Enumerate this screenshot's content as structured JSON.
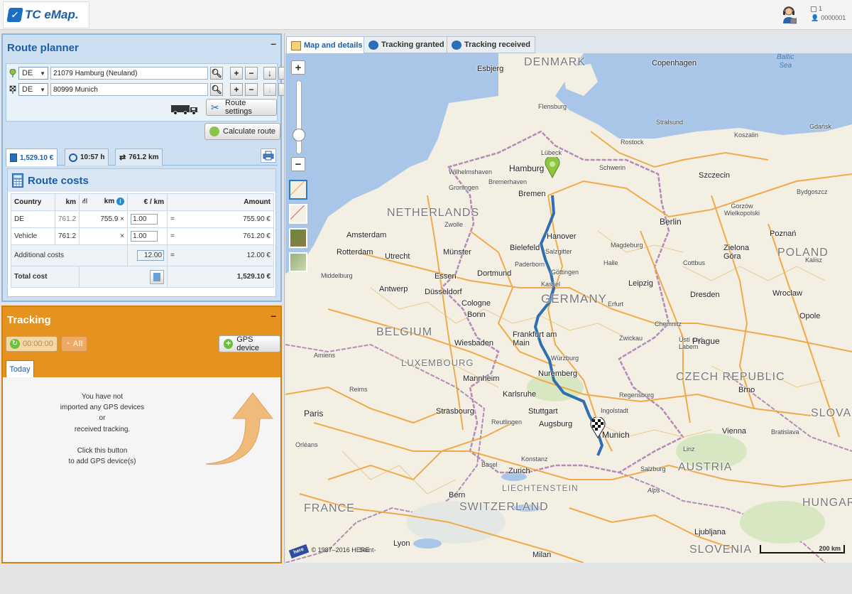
{
  "header": {
    "app_name": "TC eMap.",
    "logo_icon": "tc-logo-icon",
    "support_icon": "support-agent-icon",
    "session_count": "1",
    "account_id": "0000001"
  },
  "route_planner": {
    "title": "Route planner",
    "collapse": "–",
    "start": {
      "country": "DE",
      "address": "21079 Hamburg (Neuland)"
    },
    "end": {
      "country": "DE",
      "address": "80999 Munich"
    },
    "route_settings_label": "Route settings",
    "calculate_label": "Calculate route",
    "summary_tabs": [
      {
        "label": "1,529.10 €",
        "icon": "calculator-icon"
      },
      {
        "label": "10:57 h",
        "icon": "clock-icon"
      },
      {
        "label": "761.2 km",
        "icon": "road-sign-icon"
      }
    ],
    "costs_title": "Route costs",
    "table": {
      "headers": [
        "Country",
        "km",
        "km",
        "€ / km",
        "Amount"
      ],
      "rows": [
        {
          "country": "DE",
          "km": "761.2",
          "toll_km": "755.9 ×",
          "rate": "1.00",
          "eq": "=",
          "amount": "755.90 €"
        },
        {
          "country": "Vehicle",
          "km": "761.2",
          "toll_km": "×",
          "rate": "1.00",
          "eq": "=",
          "amount": "761.20 €"
        }
      ],
      "additional_label": "Additional costs",
      "additional_value": "12.00",
      "additional_eq": "=",
      "additional_amount": "12.00 €",
      "total_label": "Total cost",
      "total_amount": "1,529.10 €"
    }
  },
  "tracking": {
    "title": "Tracking",
    "collapse": "–",
    "timer_label": "00:00:00",
    "all_label": "All",
    "gps_device_label": "GPS device",
    "today_tab": "Today",
    "message_lines": [
      "You have not",
      "imported any GPS devices",
      "or",
      "received tracking.",
      "",
      "Click this button",
      "to add GPS device(s)"
    ]
  },
  "map": {
    "tabs": [
      {
        "label": "Map and details",
        "icon": "map-icon"
      },
      {
        "label": "Tracking granted",
        "icon": "tracking-granted-icon"
      },
      {
        "label": "Tracking received",
        "icon": "tracking-received-icon"
      }
    ],
    "zoom_in": "+",
    "zoom_out": "−",
    "copyright": "© 1987–2016 HERE",
    "scale": "200 km",
    "labels": {
      "countries": [
        "DENMARK",
        "NETHERLANDS",
        "GERMANY",
        "BELGIUM",
        "LUXEMBOURG",
        "FRANCE",
        "SWITZERLAND",
        "LIECHTENSTEIN",
        "AUSTRIA",
        "CZECH REPUBLIC",
        "POLAND",
        "SLOVENIA",
        "HUNGAR",
        "SLOVAK"
      ],
      "sea": "Baltic\nSea",
      "cities": [
        "Esbjerg",
        "Copenhagen",
        "Flensburg",
        "Lübeck",
        "Hamburg",
        "Schwerin",
        "Rostock",
        "Stralsund",
        "Koszalin",
        "Gdańsk",
        "Bremen",
        "Bremerhaven",
        "Wilhelmshaven",
        "Groningen",
        "Szczecin",
        "Bydgoszcz",
        "Gorzów Wielkopolski",
        "Berlin",
        "Poznań",
        "Amsterdam",
        "Zwolle",
        "Hanover",
        "Magdeburg",
        "Rotterdam",
        "Utrecht",
        "Münster",
        "Bielefeld",
        "Salzgitter",
        "Leipzig",
        "Cottbus",
        "Zielona Góra",
        "Middelburg",
        "Antwerp",
        "Essen",
        "Dortmund",
        "Paderborn",
        "Göttingen",
        "Halle",
        "Dresden",
        "Wroclaw",
        "Kalisz",
        "Düsseldorf",
        "Kassel",
        "Chemnitz",
        "Opole",
        "Cologne",
        "Bonn",
        "Erfurt",
        "Zwickau",
        "Ústí nad Labem",
        "Wiesbaden",
        "Frankfurt am Main",
        "Würzburg",
        "Prague",
        "Amiens",
        "Mannheim",
        "Nuremberg",
        "Regensburg",
        "Brno",
        "Reims",
        "Karlsruhe",
        "Stuttgart",
        "Ingolstadt",
        "Paris",
        "Strasbourg",
        "Augsburg",
        "Munich",
        "Vienna",
        "Bratislava",
        "Orléans",
        "Reutlingen",
        "Salzburg",
        "Linz",
        "Zurich",
        "Basel",
        "Konstanz",
        "Bern",
        "Lyon",
        "Milan",
        "Ljubljana",
        "Saint-",
        "Alps"
      ],
      "label_munich": "Munich",
      "label_hamburg": "Hamburg"
    }
  }
}
